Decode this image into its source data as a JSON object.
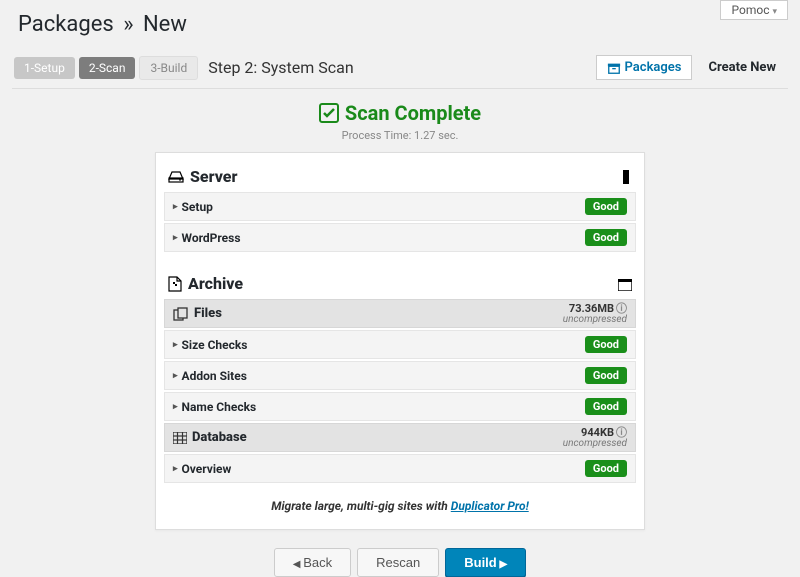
{
  "corner_menu": "Pomoc",
  "breadcrumb": {
    "root": "Packages",
    "sep": "»",
    "leaf": "New"
  },
  "steps": {
    "s1": "1-Setup",
    "s2": "2-Scan",
    "s3": "3-Build",
    "label": "Step 2: System Scan"
  },
  "toolbar": {
    "packages": "Packages",
    "create_new": "Create New"
  },
  "scan": {
    "title": "Scan Complete",
    "subtitle": "Process Time: 1.27 sec."
  },
  "server": {
    "title": "Server",
    "rows": [
      {
        "label": "Setup",
        "status": "Good"
      },
      {
        "label": "WordPress",
        "status": "Good"
      }
    ]
  },
  "archive": {
    "title": "Archive",
    "files": {
      "title": "Files",
      "size": "73.36MB",
      "comp": "uncompressed",
      "rows": [
        {
          "label": "Size Checks",
          "status": "Good"
        },
        {
          "label": "Addon Sites",
          "status": "Good"
        },
        {
          "label": "Name Checks",
          "status": "Good"
        }
      ]
    },
    "db": {
      "title": "Database",
      "size": "944KB",
      "comp": "uncompressed",
      "rows": [
        {
          "label": "Overview",
          "status": "Good"
        }
      ]
    }
  },
  "promo": {
    "pre": "Migrate large, multi-gig sites with ",
    "link": "Duplicator Pro!"
  },
  "buttons": {
    "back": "Back",
    "rescan": "Rescan",
    "build": "Build"
  }
}
